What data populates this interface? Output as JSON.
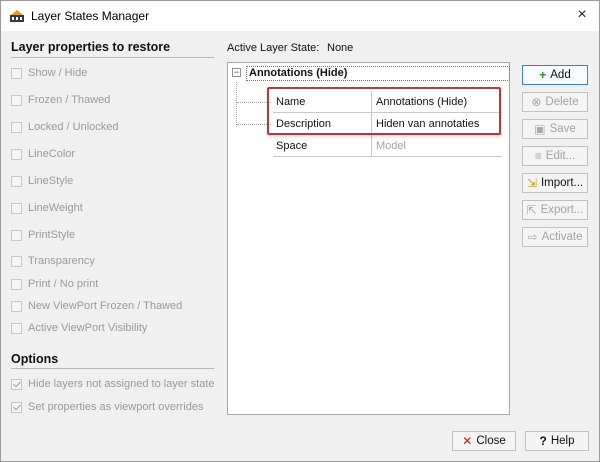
{
  "window": {
    "title": "Layer States Manager",
    "close_glyph": "×"
  },
  "restore": {
    "heading": "Layer properties to restore",
    "items": [
      {
        "label": "Show / Hide"
      },
      {
        "label": "Frozen / Thawed"
      },
      {
        "label": "Locked / Unlocked"
      },
      {
        "label": "LineColor"
      },
      {
        "label": "LineStyle"
      },
      {
        "label": "LineWeight"
      },
      {
        "label": "PrintStyle"
      },
      {
        "label": "Transparency"
      },
      {
        "label": "Print / No print"
      },
      {
        "label": "New ViewPort Frozen / Thawed"
      },
      {
        "label": "Active ViewPort Visibility"
      }
    ]
  },
  "options": {
    "heading": "Options",
    "items": [
      {
        "label": "Hide layers not assigned to layer state",
        "checked": true
      },
      {
        "label": "Set properties as viewport overrides",
        "checked": true
      }
    ]
  },
  "active_state": {
    "label": "Active Layer State:",
    "value": "None"
  },
  "tree": {
    "root_label": "Annotations (Hide)",
    "expander": "−",
    "properties": [
      {
        "key": "Name",
        "value": "Annotations (Hide)",
        "disabled": false
      },
      {
        "key": "Description",
        "value": "Hiden van annotaties",
        "disabled": false
      },
      {
        "key": "Space",
        "value": "Model",
        "disabled": true
      }
    ]
  },
  "buttons": {
    "add": "Add",
    "delete": "Delete",
    "save": "Save",
    "edit": "Edit...",
    "import": "Import...",
    "export": "Export...",
    "activate": "Activate",
    "close": "Close",
    "help": "Help"
  },
  "colors": {
    "highlight": "#b23a3a",
    "primary_border": "#3c7fd6"
  }
}
